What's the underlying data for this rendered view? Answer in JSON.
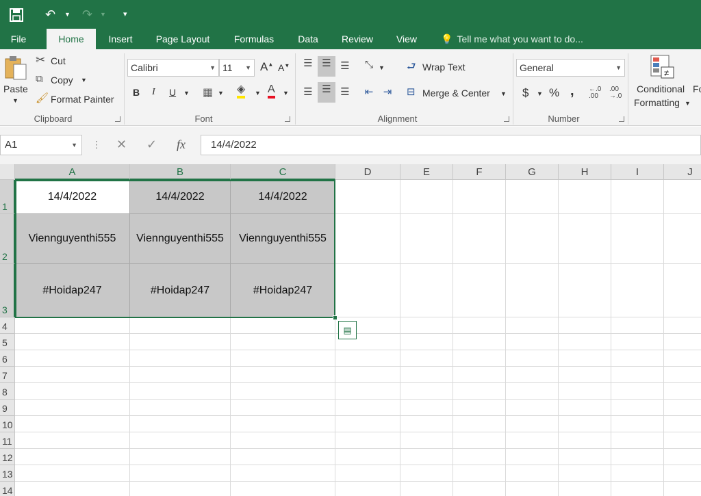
{
  "qat": {
    "save_icon": "save-icon",
    "undo_icon": "undo-icon",
    "redo_icon": "redo-icon",
    "customize_icon": "customize-qat-icon"
  },
  "tabs": [
    "File",
    "Home",
    "Insert",
    "Page Layout",
    "Formulas",
    "Data",
    "Review",
    "View"
  ],
  "active_tab": "Home",
  "tell_me": "Tell me what you want to do...",
  "clipboard": {
    "paste": "Paste",
    "cut": "Cut",
    "copy": "Copy",
    "format_painter": "Format Painter",
    "label": "Clipboard"
  },
  "font": {
    "name": "Calibri",
    "size": "11",
    "grow": "A",
    "shrink": "A",
    "bold": "B",
    "italic": "I",
    "underline": "U",
    "label": "Font"
  },
  "alignment": {
    "wrap": "Wrap Text",
    "merge": "Merge & Center",
    "label": "Alignment"
  },
  "number": {
    "format": "General",
    "currency": "$",
    "percent": "%",
    "comma": ",",
    "label": "Number"
  },
  "styles": {
    "conditional": "Conditional",
    "formatting": "Formatting",
    "next_cut": "Fo"
  },
  "formula_bar": {
    "name_box": "A1",
    "fx": "fx",
    "value": "14/4/2022"
  },
  "columns": [
    "A",
    "B",
    "C",
    "D",
    "E",
    "F",
    "G",
    "H",
    "I",
    "J"
  ],
  "rows": [
    "1",
    "2",
    "3",
    "4",
    "5",
    "6",
    "7",
    "8",
    "9",
    "10",
    "11",
    "12",
    "13",
    "14"
  ],
  "cells": {
    "r1": [
      "14/4/2022",
      "14/4/2022",
      "14/4/2022"
    ],
    "r2": [
      "Viennguyenthi555",
      "Viennguyenthi555",
      "Viennguyenthi555"
    ],
    "r3": [
      "#Hoidap247",
      "#Hoidap247",
      "#Hoidap247"
    ]
  },
  "colors": {
    "accent": "#217346",
    "selection_fill": "#c8c8c8"
  }
}
